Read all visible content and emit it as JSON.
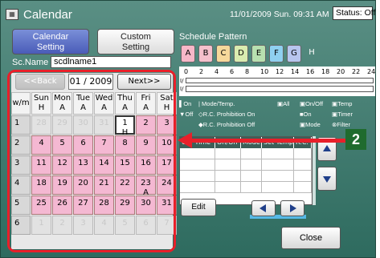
{
  "app": {
    "title": "Calendar",
    "icon": "calendar-icon"
  },
  "header": {
    "datetime": "11/01/2009 Sun. 09:31 AM",
    "status": "Status: Off"
  },
  "tabs": [
    {
      "label_line1": "Calendar",
      "label_line2": "Setting",
      "active": true
    },
    {
      "label_line1": "Custom",
      "label_line2": "Setting",
      "active": false
    }
  ],
  "sc_name": {
    "label": "Sc.Name",
    "value": "scdlname1"
  },
  "nav": {
    "back_label": "<<Back",
    "month": "01 / 2009",
    "next_label": "Next>>"
  },
  "calendar": {
    "corner": "w/m",
    "days": [
      {
        "name": "Sun",
        "pattern": "H"
      },
      {
        "name": "Mon",
        "pattern": "A"
      },
      {
        "name": "Tue",
        "pattern": "A"
      },
      {
        "name": "Wed",
        "pattern": "A"
      },
      {
        "name": "Thu",
        "pattern": "A"
      },
      {
        "name": "Fri",
        "pattern": "A"
      },
      {
        "name": "Sat",
        "pattern": "H"
      }
    ],
    "weeks": [
      {
        "num": "1",
        "cells": [
          {
            "d": "28",
            "other": true,
            "p": ""
          },
          {
            "d": "29",
            "other": true,
            "p": ""
          },
          {
            "d": "30",
            "other": true,
            "p": ""
          },
          {
            "d": "31",
            "other": true,
            "p": ""
          },
          {
            "d": "1",
            "today": true,
            "p": "H"
          },
          {
            "d": "2",
            "p": ""
          },
          {
            "d": "3",
            "p": ""
          }
        ]
      },
      {
        "num": "2",
        "cells": [
          {
            "d": "4",
            "p": ""
          },
          {
            "d": "5",
            "p": ""
          },
          {
            "d": "6",
            "p": ""
          },
          {
            "d": "7",
            "p": ""
          },
          {
            "d": "8",
            "p": ""
          },
          {
            "d": "9",
            "p": ""
          },
          {
            "d": "10",
            "p": ""
          }
        ]
      },
      {
        "num": "3",
        "cells": [
          {
            "d": "11",
            "p": ""
          },
          {
            "d": "12",
            "p": ""
          },
          {
            "d": "13",
            "p": ""
          },
          {
            "d": "14",
            "p": ""
          },
          {
            "d": "15",
            "p": ""
          },
          {
            "d": "16",
            "p": ""
          },
          {
            "d": "17",
            "p": ""
          }
        ]
      },
      {
        "num": "4",
        "cells": [
          {
            "d": "18",
            "p": ""
          },
          {
            "d": "19",
            "p": ""
          },
          {
            "d": "20",
            "p": ""
          },
          {
            "d": "21",
            "p": ""
          },
          {
            "d": "22",
            "p": ""
          },
          {
            "d": "23",
            "p": "A"
          },
          {
            "d": "24",
            "p": ""
          }
        ]
      },
      {
        "num": "5",
        "cells": [
          {
            "d": "25",
            "p": ""
          },
          {
            "d": "26",
            "p": ""
          },
          {
            "d": "27",
            "p": ""
          },
          {
            "d": "28",
            "p": ""
          },
          {
            "d": "29",
            "p": ""
          },
          {
            "d": "30",
            "p": ""
          },
          {
            "d": "31",
            "p": ""
          }
        ]
      },
      {
        "num": "6",
        "cells": [
          {
            "d": "1",
            "other": true,
            "p": ""
          },
          {
            "d": "2",
            "other": true,
            "p": ""
          },
          {
            "d": "3",
            "other": true,
            "p": ""
          },
          {
            "d": "4",
            "other": true,
            "p": ""
          },
          {
            "d": "5",
            "other": true,
            "p": ""
          },
          {
            "d": "6",
            "other": true,
            "p": ""
          },
          {
            "d": "7",
            "other": true,
            "p": ""
          }
        ]
      }
    ]
  },
  "schedule_pattern": {
    "title": "Schedule Pattern",
    "buttons": [
      {
        "label": "A",
        "color": "#f7b7c8"
      },
      {
        "label": "B",
        "color": "#f4c0cc"
      },
      {
        "label": "C",
        "color": "#f6d89a"
      },
      {
        "label": "D",
        "color": "#d9ecb0"
      },
      {
        "label": "E",
        "color": "#b8e0b0"
      },
      {
        "label": "F",
        "color": "#8fd0f0"
      },
      {
        "label": "G",
        "color": "#b7c5ee"
      },
      {
        "label": "H",
        "color": "#ffffff"
      }
    ],
    "hours": [
      "0",
      "2",
      "4",
      "6",
      "8",
      "10",
      "12",
      "14",
      "16",
      "18",
      "20",
      "22",
      "24"
    ]
  },
  "legend": {
    "on": "On",
    "off": "Off",
    "mode_temp": "Mode/Temp.",
    "rc_prohib_on": "R.C. Prohibition On",
    "rc_prohib_off": "R.C. Prohibition Off",
    "all": "All",
    "onoff": "On/Off",
    "temp": "Temp",
    "on2": "On",
    "timer": "Timer",
    "mode": "Mode",
    "filter": "Filter"
  },
  "table": {
    "headers": [
      "Op. Time",
      "On/Off",
      "Mode",
      "Set Temp",
      "R.C."
    ]
  },
  "buttons": {
    "edit": "Edit",
    "close": "Close"
  },
  "annotation": {
    "badge": "2",
    "color": "#e8202a"
  }
}
